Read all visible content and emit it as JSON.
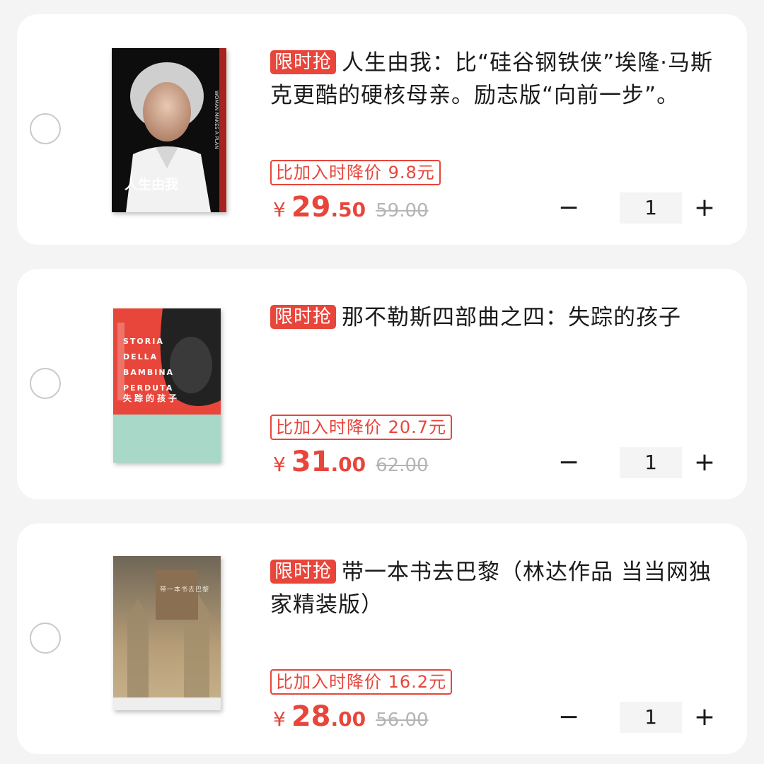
{
  "items": [
    {
      "badge": "限时抢",
      "title": "人生由我：比“硅谷钢铁侠”埃隆·马斯克更酷的硬核母亲。励志版“向前一步”。",
      "price_drop": "比加入时降价 9.8元",
      "currency": "¥",
      "price_int": "29",
      "price_dec": ".50",
      "original_price": "59.00",
      "quantity": "1",
      "cover_text": "人生由我",
      "cover_colors": [
        "#111111",
        "#c0392b"
      ]
    },
    {
      "badge": "限时抢",
      "title": "那不勒斯四部曲之四：失踪的孩子",
      "price_drop": "比加入时降价 20.7元",
      "currency": "¥",
      "price_int": "31",
      "price_dec": ".00",
      "original_price": "62.00",
      "quantity": "1",
      "cover_text_en": "STORIA DELLA BAMBINA PERDUTA",
      "cover_text": "失踪的孩子",
      "cover_colors": [
        "#e8463a",
        "#a8d8c8"
      ]
    },
    {
      "badge": "限时抢",
      "title": "带一本书去巴黎（林达作品  当当网独家精装版）",
      "price_drop": "比加入时降价 16.2元",
      "currency": "¥",
      "price_int": "28",
      "price_dec": ".00",
      "original_price": "56.00",
      "quantity": "1",
      "cover_text": "带一本书去巴黎",
      "cover_colors": [
        "#7a6a55",
        "#b9a27f"
      ]
    }
  ],
  "controls": {
    "minus": "−",
    "plus": "+"
  }
}
